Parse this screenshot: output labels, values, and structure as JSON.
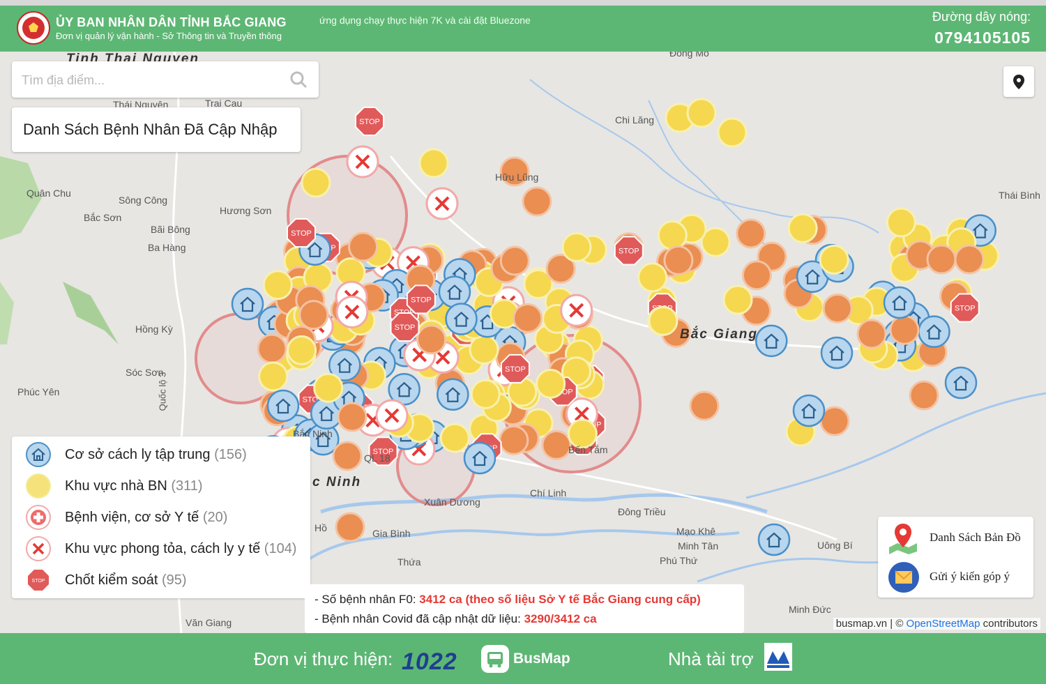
{
  "header": {
    "title": "ỦY BAN NHÂN DÂN TỈNH BẮC GIANG",
    "subtitle": "Đơn vị quản lý vận hành - Sở Thông tin và Truyền thông",
    "ticker": "ứng dụng chạy thực hiện 7K và cài đặt Bluezone",
    "hotline_label": "Đường dây nóng:",
    "hotline_number": "0794105105"
  },
  "search": {
    "placeholder": "Tìm địa điểm..."
  },
  "list_button": {
    "label": "Danh Sách Bệnh Nhân Đã Cập Nhập"
  },
  "map_places": [
    {
      "name": "Tinh Thai Nguyen",
      "big": true
    },
    {
      "name": "Đồng Mỏ"
    },
    {
      "name": "Thái Nguyên"
    },
    {
      "name": "Trại Cau"
    },
    {
      "name": "Chi Lăng"
    },
    {
      "name": "Hữu Lũng"
    },
    {
      "name": "Quân Chu"
    },
    {
      "name": "Sông Công"
    },
    {
      "name": "Bắc Sơn"
    },
    {
      "name": "Hương Sơn"
    },
    {
      "name": "Bãi Bông"
    },
    {
      "name": "Ba Hàng"
    },
    {
      "name": "Thái Bình"
    },
    {
      "name": "Hồng Kỳ"
    },
    {
      "name": "Bắc Giang",
      "big": true
    },
    {
      "name": "Sóc Sơn"
    },
    {
      "name": "Phúc Yên"
    },
    {
      "name": "Quốc lộ 3"
    },
    {
      "name": "Bến Tắm"
    },
    {
      "name": "QL 18"
    },
    {
      "name": "c Ninh",
      "big": true
    },
    {
      "name": "Chí Linh"
    },
    {
      "name": "Xuân Dương"
    },
    {
      "name": "Đông Triều"
    },
    {
      "name": "Gia Bình"
    },
    {
      "name": "Mạo Khê"
    },
    {
      "name": "Minh Tân"
    },
    {
      "name": "Phú Thứ"
    },
    {
      "name": "Uông Bí"
    },
    {
      "name": "Thứa"
    },
    {
      "name": "Minh Đức"
    },
    {
      "name": "Văn Giang"
    },
    {
      "name": "Hồ"
    },
    {
      "name": "Bắc Ninh"
    }
  ],
  "legend": {
    "items": [
      {
        "label": "Cơ sở cách ly tập trung",
        "count": "(156)",
        "icon": "house-icon"
      },
      {
        "label": "Khu vực nhà BN",
        "count": "(311)",
        "icon": "yellow-dot-icon"
      },
      {
        "label": "Bệnh viện, cơ sở Y tế",
        "count": "(20)",
        "icon": "hospital-icon"
      },
      {
        "label": "Khu vực phong tỏa, cách ly y tế",
        "count": "(104)",
        "icon": "x-icon"
      },
      {
        "label": "Chốt kiểm soát",
        "count": "(95)",
        "icon": "stop-icon"
      }
    ]
  },
  "stats": {
    "line1_prefix": "- Số bệnh nhân F0: ",
    "line1_value": "3412 ca (theo số liệu Sở Y tế Bắc Giang cung cấp)",
    "line2_prefix": "- Bệnh nhân Covid đã cập nhật dữ liệu: ",
    "line2_value": "3290/3412 ca"
  },
  "right_panel": {
    "items": [
      {
        "label": "Danh Sách Bản Đồ",
        "icon": "map-pin-icon"
      },
      {
        "label": "Gửi ý kiến góp ý",
        "icon": "mail-icon"
      }
    ]
  },
  "attribution": {
    "site": "busmap.vn",
    "sep": " | © ",
    "osm": "OpenStreetMap",
    "suffix": " contributors"
  },
  "footer": {
    "implementer_label": "Đơn vị thực hiện:",
    "logo_1022": "1022",
    "busmap_label": "BusMap",
    "sponsor_label": "Nhà tài trợ"
  },
  "colors": {
    "header_green": "#5db774",
    "stat_red": "#e53935",
    "house_blue": "#4a90c8",
    "case_yellow": "#f5d33f",
    "case_orange": "#e98a4a",
    "stop_red": "#e05a5a"
  }
}
